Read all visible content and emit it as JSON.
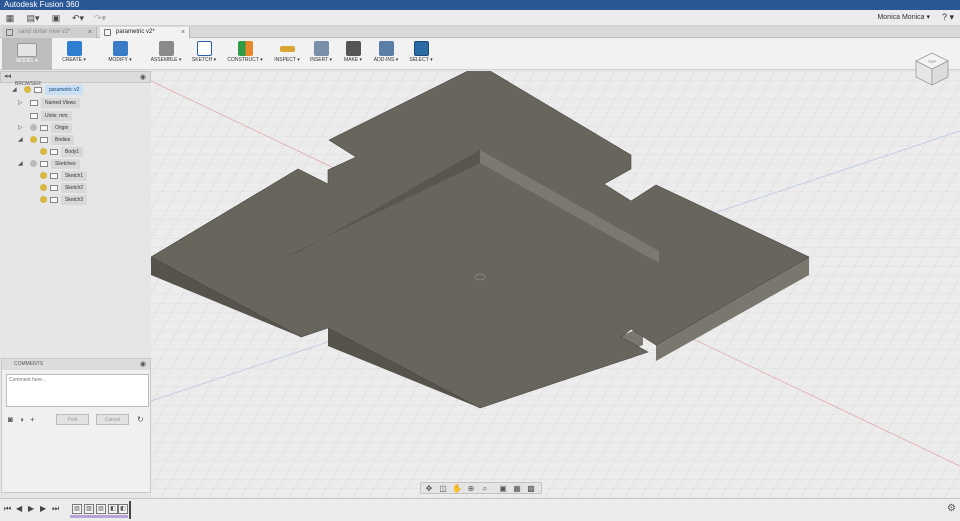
{
  "app": {
    "title": "Autodesk Fusion 360"
  },
  "appbar": {
    "user_name": "Monica Monica ▾",
    "help": "? ▾"
  },
  "tabs": [
    {
      "label": "sand dollar new v2*",
      "active": false
    },
    {
      "label": "parametric v2*",
      "active": true
    }
  ],
  "toolbar": {
    "model_label": "MODEL ▾",
    "items": [
      {
        "label": "CREATE ▾",
        "icon": "create-icon",
        "color": "#2e7fd1"
      },
      {
        "label": "MODIFY ▾",
        "icon": "modify-icon",
        "color": "#3a7bc8"
      },
      {
        "label": "ASSEMBLE ▾",
        "icon": "assemble-icon",
        "color": "#6a6a6a"
      },
      {
        "label": "SKETCH ▾",
        "icon": "sketch-icon",
        "color": "#2a5fa8"
      },
      {
        "label": "CONSTRUCT ▾",
        "icon": "construct-icon",
        "color": "#e8862a"
      },
      {
        "label": "INSPECT ▾",
        "icon": "inspect-icon",
        "color": "#d9a532"
      },
      {
        "label": "INSERT ▾",
        "icon": "insert-icon",
        "color": "#7a8fa8"
      },
      {
        "label": "MAKE ▾",
        "icon": "make-icon",
        "color": "#555555"
      },
      {
        "label": "ADD-INS ▾",
        "icon": "addins-icon",
        "color": "#5b7ea6"
      },
      {
        "label": "SELECT ▾",
        "icon": "select-icon",
        "color": "#2a6aa3"
      }
    ]
  },
  "browser": {
    "title": "BROWSER",
    "tree": [
      {
        "label": "parametric v2",
        "kind": "root"
      },
      {
        "label": "Named Views",
        "kind": "folder"
      },
      {
        "label": "Units: mm",
        "kind": "doc"
      },
      {
        "label": "Origin",
        "kind": "folder-bulb"
      },
      {
        "label": "Bodies",
        "kind": "folder-bulb"
      },
      {
        "label": "Body1",
        "kind": "body"
      },
      {
        "label": "Sketches",
        "kind": "folder-bulb"
      },
      {
        "label": "Sketch1",
        "kind": "sketch"
      },
      {
        "label": "Sketch2",
        "kind": "sketch"
      },
      {
        "label": "Sketch3",
        "kind": "sketch"
      }
    ]
  },
  "comments": {
    "title": "COMMENTS",
    "placeholder": "Comment here...",
    "post_label": "Post",
    "cancel_label": "Cancel"
  },
  "viewcube": {
    "label": "TOP"
  },
  "colors": {
    "body_top": "#68655d",
    "body_left": "#55534c",
    "body_right": "#7a776f",
    "grid": "#d4d4d4",
    "accent": "#2a6aa3"
  }
}
